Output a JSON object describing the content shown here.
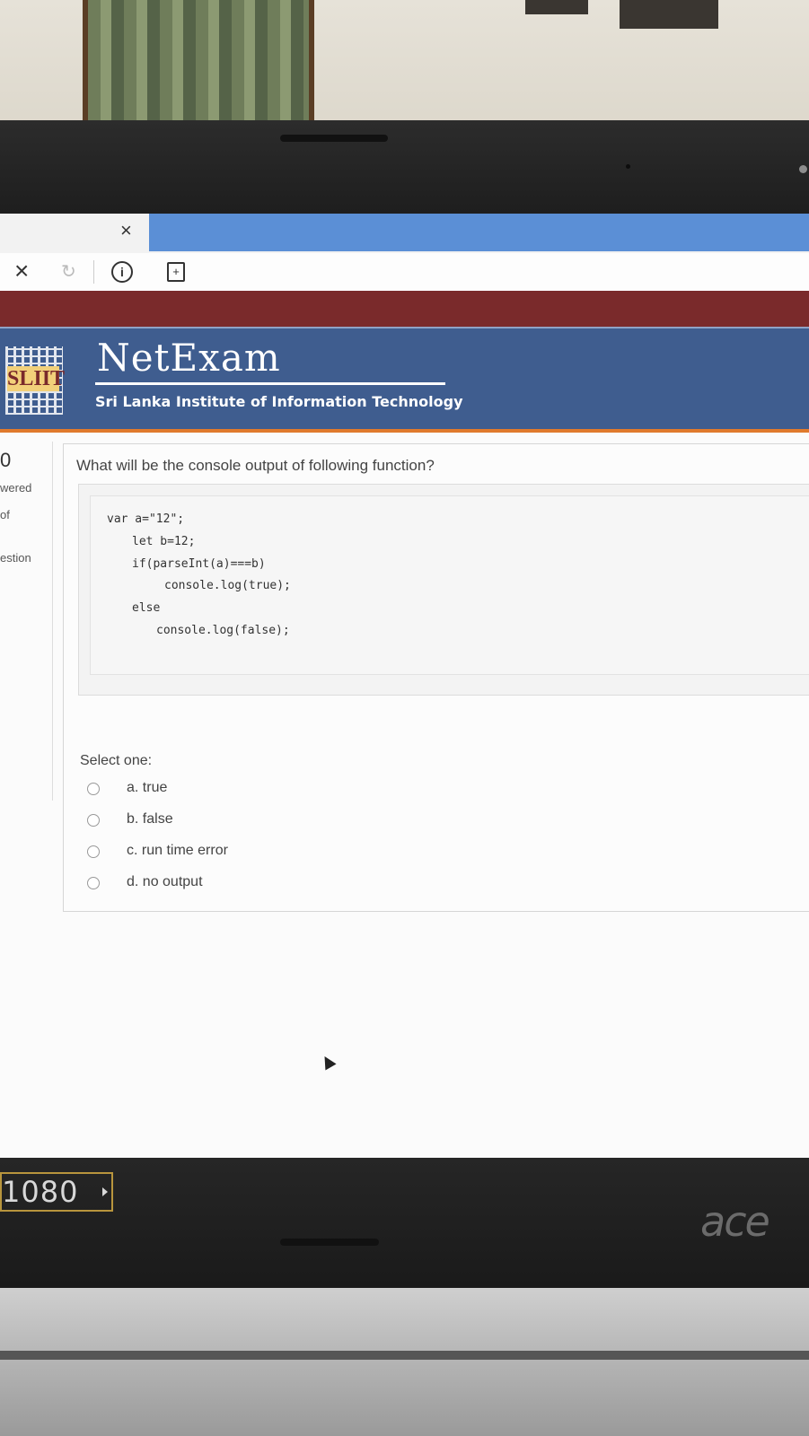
{
  "browser": {
    "tab_close_glyph": "×",
    "nav_close_glyph": "×",
    "reload_glyph": "↻",
    "info_glyph": "i",
    "save_glyph": "+"
  },
  "header": {
    "brand": "NetExam",
    "subtitle": "Sri Lanka Institute of Information Technology",
    "logo_text": "SLIIT"
  },
  "left_panel": {
    "number": "0",
    "line1": "wered",
    "line2": "of",
    "line3": "estion"
  },
  "question": {
    "text": "What will be the console  output of following function?",
    "code": [
      "var a=\"12\";",
      "let b=12;",
      "if(parseInt(a)===b)",
      "console.log(true);",
      "else",
      "console.log(false);"
    ],
    "select_label": "Select one:",
    "options": [
      {
        "label": "a. true"
      },
      {
        "label": "b. false"
      },
      {
        "label": "c. run time error"
      },
      {
        "label": "d. no output"
      }
    ]
  },
  "laptop": {
    "badge": "1080",
    "brand": "ace"
  },
  "colors": {
    "header_blue": "#3f5d8f",
    "maroon_bar": "#7a2a2b",
    "accent_orange": "#e07a2c",
    "tab_blue": "#5b8fd6"
  }
}
